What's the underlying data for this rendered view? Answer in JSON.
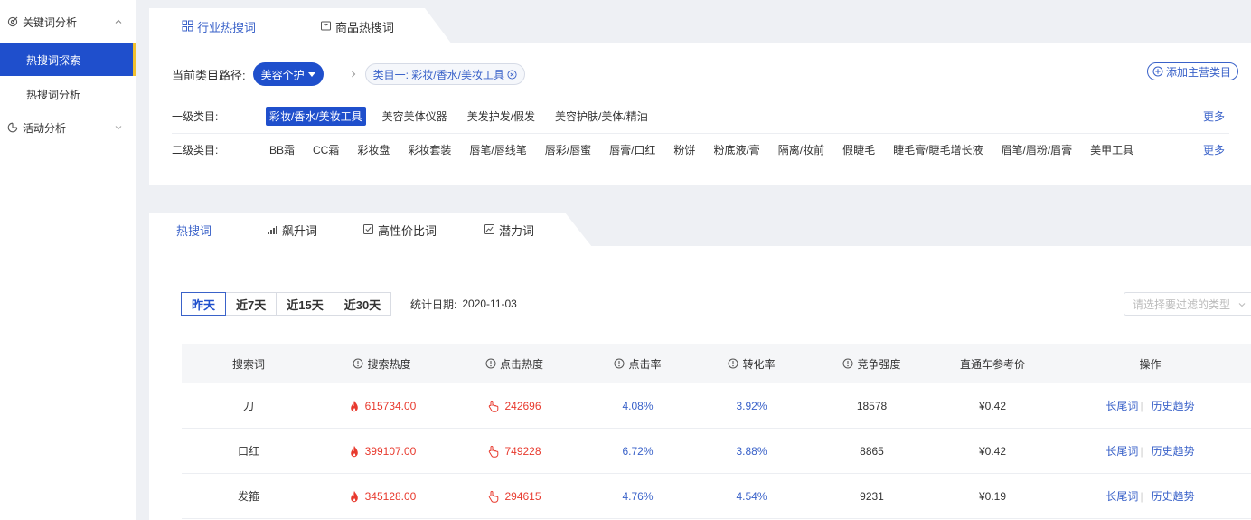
{
  "sidebar": {
    "groups": [
      {
        "label": "关键词分析",
        "expanded": true,
        "items": [
          "热搜词探索",
          "热搜词分析"
        ]
      },
      {
        "label": "活动分析",
        "expanded": false
      }
    ],
    "active_item": "热搜词探索"
  },
  "top_tabs": [
    "行业热搜词",
    "商品热搜词"
  ],
  "active_top_tab": "行业热搜词",
  "path": {
    "label": "当前类目路径:",
    "root": "美容个护",
    "tag": "类目一:  彩妆/香水/美妆工具",
    "add_button": "添加主营类目"
  },
  "level1": {
    "label": "一级类目:",
    "options": [
      "彩妆/香水/美妆工具",
      "美容美体仪器",
      "美发护发/假发",
      "美容护肤/美体/精油"
    ],
    "selected": "彩妆/香水/美妆工具",
    "more": "更多"
  },
  "level2": {
    "label": "二级类目:",
    "options": [
      "BB霜",
      "CC霜",
      "彩妆盘",
      "彩妆套装",
      "唇笔/唇线笔",
      "唇彩/唇蜜",
      "唇膏/口红",
      "粉饼",
      "粉底液/膏",
      "隔离/妆前",
      "假睫毛",
      "睫毛膏/睫毛增长液",
      "眉笔/眉粉/眉膏",
      "美甲工具"
    ],
    "more": "更多"
  },
  "sub_tabs": [
    "热搜词",
    "飙升词",
    "高性价比词",
    "潜力词"
  ],
  "active_sub_tab": "热搜词",
  "ranges": [
    "昨天",
    "近7天",
    "近15天",
    "近30天"
  ],
  "active_range": "昨天",
  "stat": {
    "label": "统计日期:",
    "date": "2020-11-03"
  },
  "filter": {
    "placeholder": "请选择要过滤的类型"
  },
  "table": {
    "headers": [
      "搜索词",
      "搜索热度",
      "点击热度",
      "点击率",
      "转化率",
      "竞争强度",
      "直通车参考价",
      "操作"
    ],
    "rows": [
      {
        "word": "刀",
        "search_heat": "615734.00",
        "click_heat": "242696",
        "ctr": "4.08%",
        "cvr": "3.92%",
        "competition": "18578",
        "price": "¥0.42"
      },
      {
        "word": "口红",
        "search_heat": "399107.00",
        "click_heat": "749228",
        "ctr": "6.72%",
        "cvr": "3.88%",
        "competition": "8865",
        "price": "¥0.42"
      },
      {
        "word": "发箍",
        "search_heat": "345128.00",
        "click_heat": "294615",
        "ctr": "4.76%",
        "cvr": "4.54%",
        "competition": "9231",
        "price": "¥0.19"
      }
    ],
    "actions": [
      "长尾词",
      "历史趋势"
    ]
  },
  "colors": {
    "primary": "#1f4fcc",
    "link": "#3a62c9",
    "hot": "#e83a2e",
    "accent": "#f2c12e"
  }
}
